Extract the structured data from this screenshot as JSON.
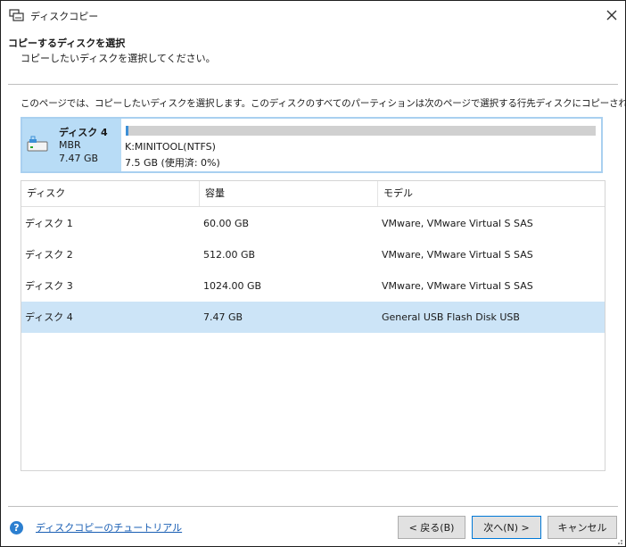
{
  "window": {
    "title": "ディスクコピー",
    "app_icon": "disk-copy-icon",
    "close_icon": "close-icon"
  },
  "header": {
    "title": "コピーするディスクを選択",
    "subtitle": "コピーしたいディスクを選択してください。"
  },
  "description": "このページでは、コピーしたいディスクを選択します。このディスクのすべてのパーティションは次のページで選択する行先ディスクにコピーされます。",
  "selected_disk": {
    "name": "ディスク 4",
    "style": "MBR",
    "size": "7.47 GB",
    "icon": "usb-drive-icon",
    "partition": {
      "label": "K:MINITOOL(NTFS)",
      "usage": "7.5 GB (使用済: 0%)",
      "used_fraction": 0.006
    }
  },
  "table": {
    "columns": [
      "ディスク",
      "容量",
      "モデル"
    ],
    "rows": [
      {
        "disk": "ディスク 1",
        "capacity": "60.00 GB",
        "model": "VMware, VMware Virtual S SAS",
        "selected": false
      },
      {
        "disk": "ディスク 2",
        "capacity": "512.00 GB",
        "model": "VMware, VMware Virtual S SAS",
        "selected": false
      },
      {
        "disk": "ディスク 3",
        "capacity": "1024.00 GB",
        "model": "VMware, VMware Virtual S SAS",
        "selected": false
      },
      {
        "disk": "ディスク 4",
        "capacity": "7.47 GB",
        "model": "General USB Flash Disk USB",
        "selected": true
      }
    ]
  },
  "footer": {
    "help_icon": "help-icon",
    "help_icon_glyph": "?",
    "help_link": "ディスクコピーのチュートリアル",
    "back_label": "< 戻る(B)",
    "next_label": "次へ(N) >",
    "cancel_label": "キャンセル"
  },
  "colors": {
    "selection": "#cce4f7",
    "card_left": "#b8dcf6",
    "card_border": "#a9d0f0",
    "accent": "#0078d7",
    "usage_fill": "#3c8fd6",
    "link": "#1a5fb4"
  }
}
